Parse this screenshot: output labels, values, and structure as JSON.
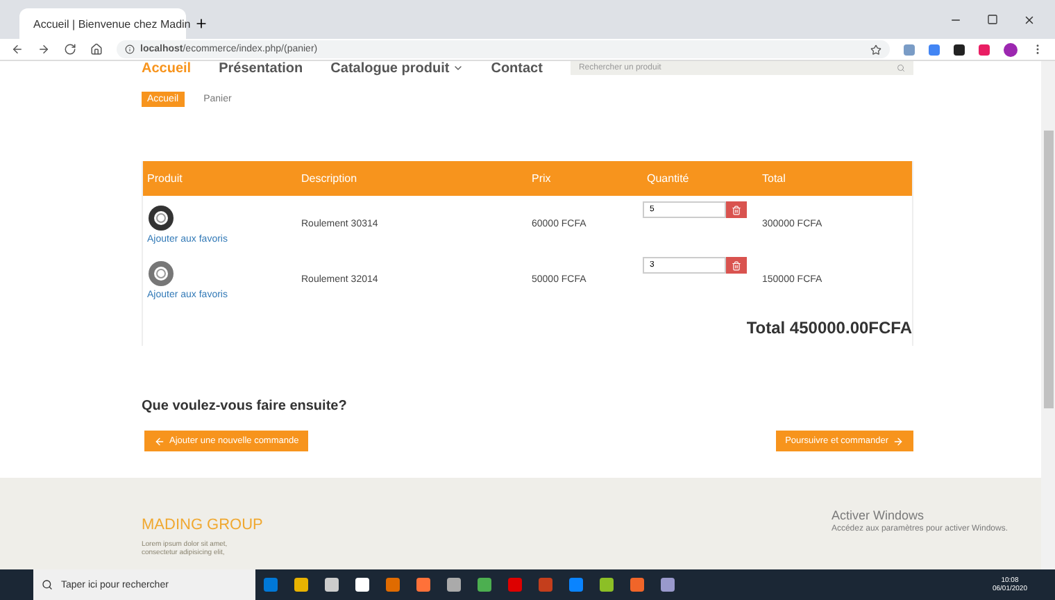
{
  "browser": {
    "tab_title": "Accueil | Bienvenue chez Madin",
    "url_host": "localhost",
    "url_path": "/ecommerce/index.php/(panier)"
  },
  "nav": {
    "items": [
      {
        "label": "Accueil",
        "selected": true
      },
      {
        "label": "Présentation",
        "selected": false
      },
      {
        "label": "Catalogue produit",
        "selected": false,
        "dropdown": true
      },
      {
        "label": "Contact",
        "selected": false
      }
    ],
    "search_placeholder": "Rechercher un produit"
  },
  "breadcrumb": [
    {
      "label": "Accueil",
      "selected": true
    },
    {
      "label": "Panier",
      "selected": false
    }
  ],
  "table": {
    "columns": [
      "Produit",
      "Description",
      "Prix",
      "Quantité",
      "Total"
    ],
    "rows": [
      {
        "link": "Ajouter aux favoris",
        "description": "Roulement 30314",
        "price": "60000 FCFA",
        "quantity": "5",
        "total": "300000 FCFA"
      },
      {
        "link": "Ajouter aux favoris",
        "description": "Roulement 32014",
        "price": "50000 FCFA",
        "quantity": "3",
        "total": "150000 FCFA"
      }
    ],
    "grand_total": "Total 450000.00FCFA"
  },
  "next": {
    "question": "Que voulez-vous faire ensuite?",
    "back_button": "Ajouter une nouvelle commande",
    "continue_button": "Poursuivre et commander"
  },
  "footer": {
    "brand": "MADING GROUP",
    "text": "Lorem ipsum dolor sit amet, consectetur adipisicing elit,"
  },
  "activation": {
    "title": "Activer Windows",
    "text": "Accédez aux paramètres pour activer Windows."
  },
  "taskbar": {
    "search_placeholder": "Taper ici pour rechercher",
    "time": "10:08",
    "date": "06/01/2020"
  }
}
